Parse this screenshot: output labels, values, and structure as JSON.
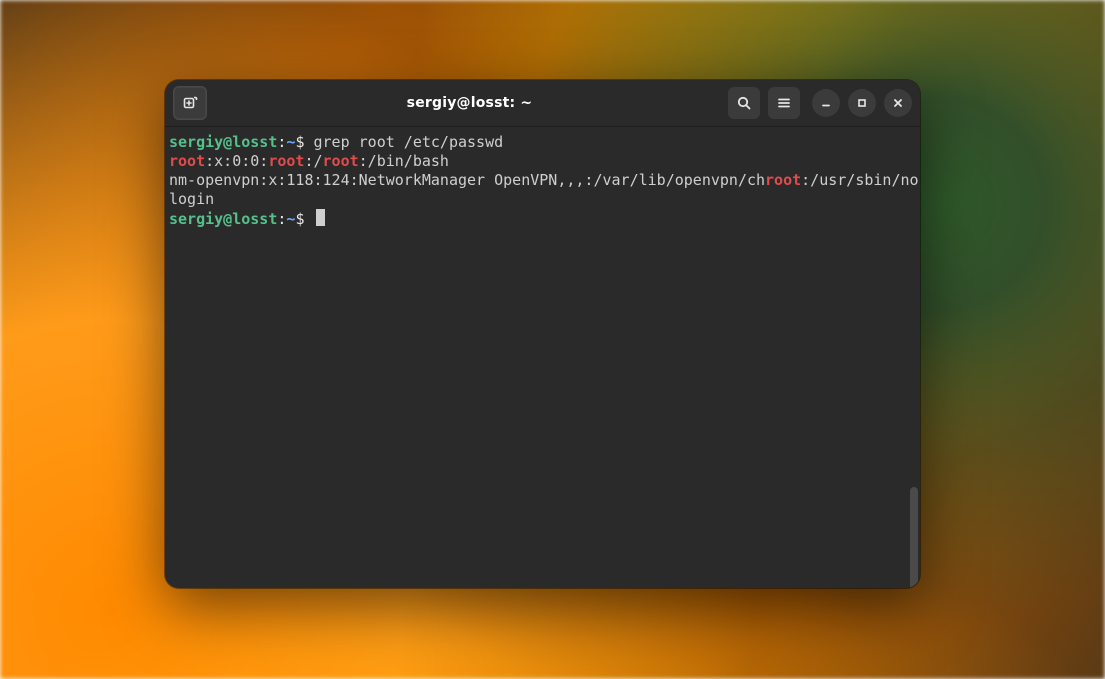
{
  "window": {
    "title": "sergiy@losst: ~"
  },
  "prompt": {
    "user_host": "sergiy@losst",
    "sep1": ":",
    "cwd": "~",
    "sigil": "$ "
  },
  "lines": {
    "cmd1": "grep root /etc/passwd",
    "out1_a": ":x:0:0:",
    "out1_b": ":/",
    "out1_c": ":/bin/bash",
    "out2_a": "nm-openvpn:x:118:124:NetworkManager OpenVPN,,,:/var/lib/openvpn/ch",
    "out2_b": ":/usr/sbin/nologin",
    "hl_root": "root"
  },
  "icons": {
    "newtab": "new-tab-icon",
    "search": "search-icon",
    "menu": "hamburger-menu-icon",
    "minimize": "minimize-icon",
    "maximize": "maximize-icon",
    "close": "close-icon"
  }
}
